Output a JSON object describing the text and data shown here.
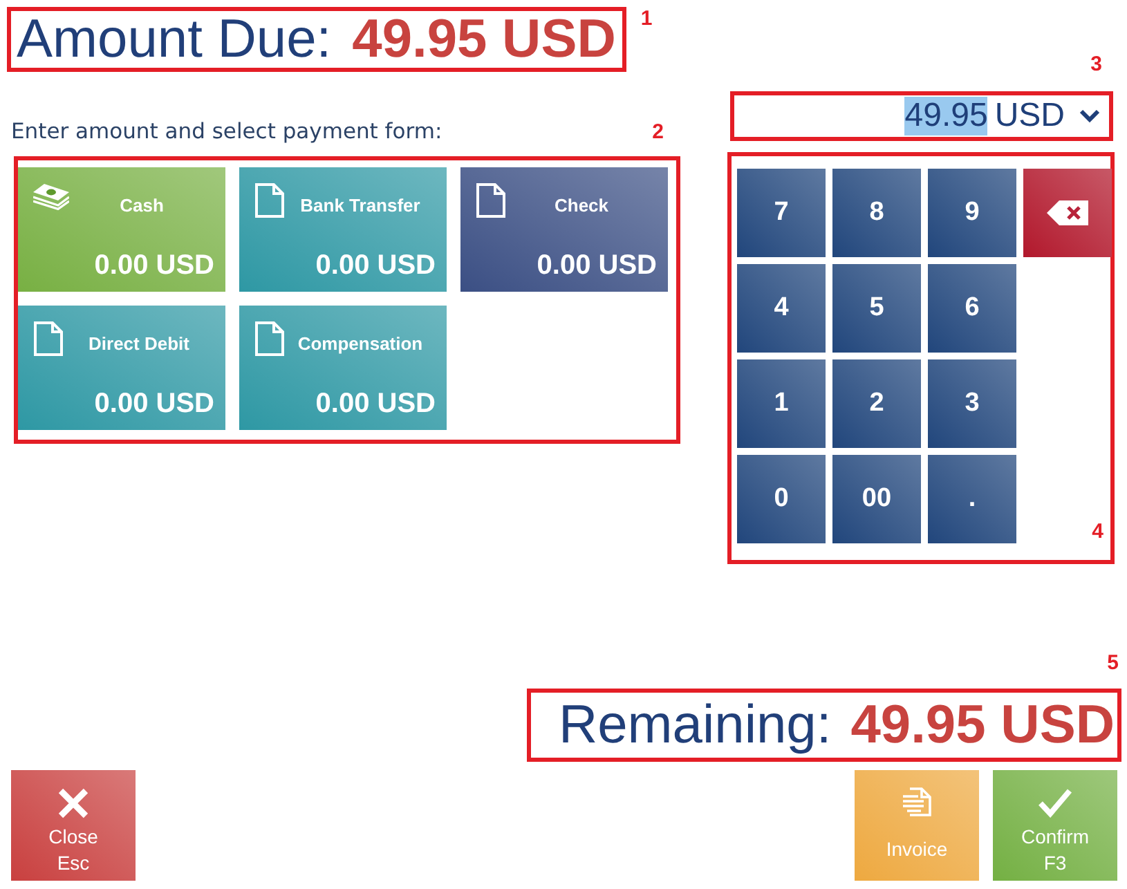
{
  "amount_due": {
    "label": "Amount Due:",
    "value": "49.95 USD",
    "callout": "1"
  },
  "payment": {
    "instruction": "Enter amount and select payment form:",
    "callout": "2",
    "forms": [
      {
        "kind": "cash",
        "name": "Cash",
        "amount": "0.00 USD",
        "color": "#78b043"
      },
      {
        "kind": "document",
        "name": "Bank Transfer",
        "amount": "0.00 USD",
        "color": "#2e98a4"
      },
      {
        "kind": "document",
        "name": "Check",
        "amount": "0.00 USD",
        "color": "#3b4f84"
      },
      {
        "kind": "document",
        "name": "Direct Debit",
        "amount": "0.00 USD",
        "color": "#2e98a4"
      },
      {
        "kind": "document",
        "name": "Compensation",
        "amount": "0.00 USD",
        "color": "#2e98a4"
      }
    ]
  },
  "amount_field": {
    "value": "49.95",
    "value_selected": true,
    "currency": "USD",
    "callout": "3"
  },
  "keypad": {
    "callout": "4",
    "rows": [
      [
        {
          "kind": "char",
          "label": "7"
        },
        {
          "kind": "char",
          "label": "8"
        },
        {
          "kind": "char",
          "label": "9"
        },
        {
          "kind": "backspace"
        }
      ],
      [
        {
          "kind": "char",
          "label": "4"
        },
        {
          "kind": "char",
          "label": "5"
        },
        {
          "kind": "char",
          "label": "6"
        }
      ],
      [
        {
          "kind": "char",
          "label": "1"
        },
        {
          "kind": "char",
          "label": "2"
        },
        {
          "kind": "char",
          "label": "3"
        }
      ],
      [
        {
          "kind": "char",
          "label": "0"
        },
        {
          "kind": "char",
          "label": "00"
        },
        {
          "kind": "char",
          "label": "."
        }
      ]
    ]
  },
  "remaining": {
    "label": "Remaining:",
    "value": "49.95 USD",
    "callout": "5"
  },
  "buttons": [
    {
      "kind": "close",
      "label": "Close",
      "shortcut": "Esc"
    },
    {
      "kind": "invoice",
      "label": "Invoice"
    },
    {
      "kind": "confirm",
      "label": "Confirm",
      "shortcut": "F3"
    }
  ]
}
